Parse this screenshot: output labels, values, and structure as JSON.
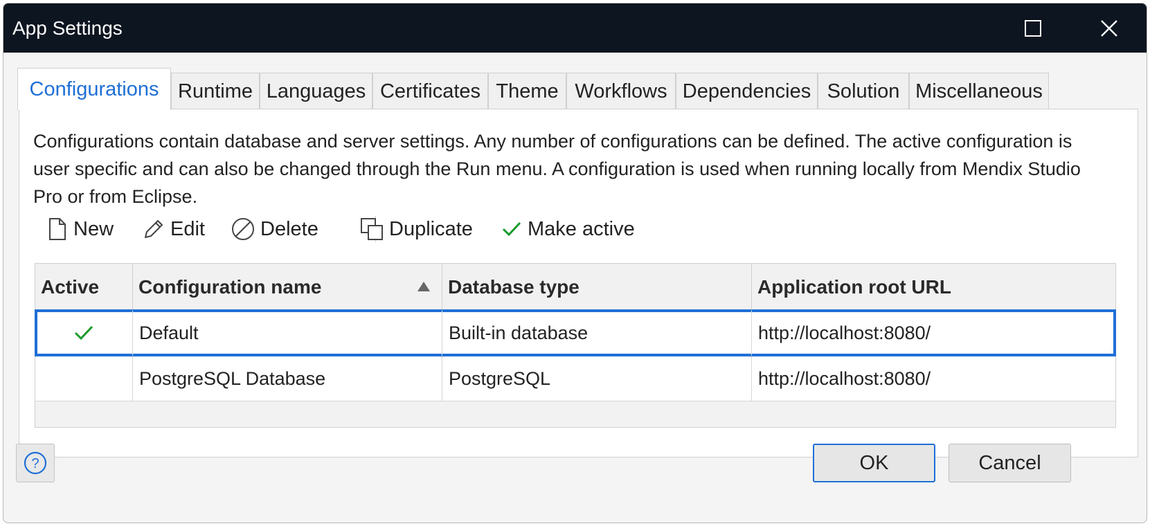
{
  "window": {
    "title": "App Settings"
  },
  "tabs": [
    {
      "label": "Configurations",
      "active": true
    },
    {
      "label": "Runtime"
    },
    {
      "label": "Languages"
    },
    {
      "label": "Certificates"
    },
    {
      "label": "Theme"
    },
    {
      "label": "Workflows"
    },
    {
      "label": "Dependencies"
    },
    {
      "label": "Solution"
    },
    {
      "label": "Miscellaneous"
    }
  ],
  "description": "Configurations contain database and server settings. Any number of configurations can be defined. The active configuration is user specific and can also be changed through the Run menu. A configuration is used when running locally from Mendix Studio Pro or from Eclipse.",
  "toolbar": {
    "new_label": "New",
    "edit_label": "Edit",
    "delete_label": "Delete",
    "duplicate_label": "Duplicate",
    "make_active_label": "Make active"
  },
  "table": {
    "columns": [
      "Active",
      "Configuration name",
      "Database type",
      "Application root URL"
    ],
    "sort": {
      "column": "Configuration name",
      "direction": "ascending"
    },
    "rows": [
      {
        "active": true,
        "name": "Default",
        "database_type": "Built-in database",
        "url": "http://localhost:8080/",
        "selected": true
      },
      {
        "active": false,
        "name": "PostgreSQL Database",
        "database_type": "PostgreSQL",
        "url": "http://localhost:8080/",
        "selected": false
      }
    ]
  },
  "footer": {
    "ok_label": "OK",
    "cancel_label": "Cancel",
    "help_icon": "help-icon"
  },
  "colors": {
    "titlebar": "#0d1520",
    "accent": "#1f6fd6",
    "check": "#1a9a2a"
  }
}
